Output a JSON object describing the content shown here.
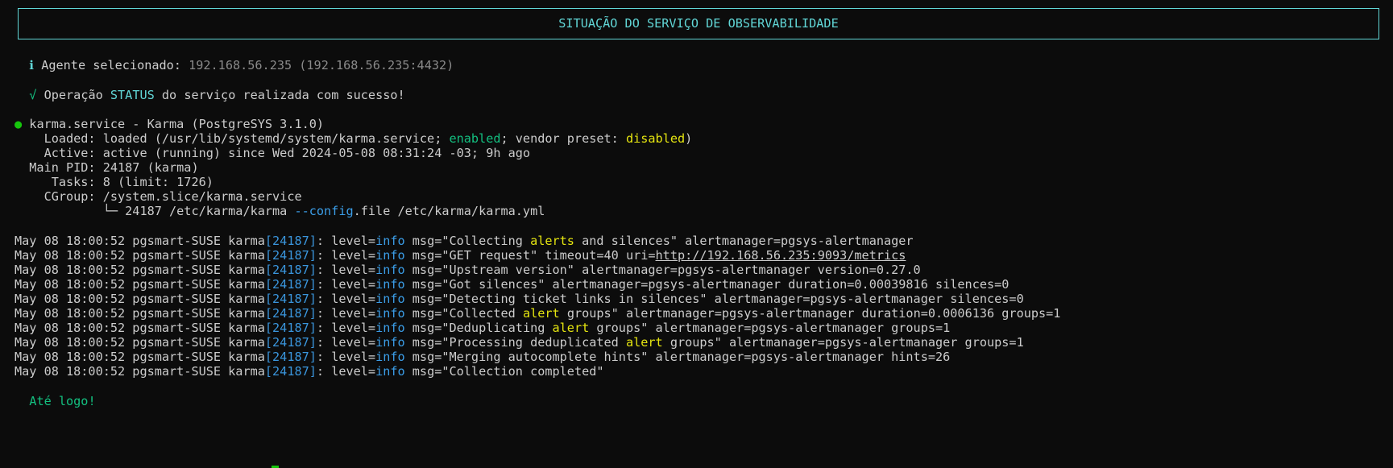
{
  "banner": {
    "title": "SITUAÇÃO DO SERVIÇO DE OBSERVABILIDADE"
  },
  "agent": {
    "icon": "ℹ",
    "label": " Agente selecionado: ",
    "value": "192.168.56.235 (192.168.56.235:4432)"
  },
  "operation": {
    "icon": "√",
    "prefix": " Operação ",
    "keyword": "STATUS",
    "suffix": " do serviço realizada com sucesso!"
  },
  "service": {
    "bullet": "●",
    "header": " karma.service - Karma (PostgreSYS 3.1.0)",
    "loaded_prefix": "    Loaded: loaded (/usr/lib/systemd/system/karma.service; ",
    "loaded_enabled": "enabled",
    "loaded_mid": "; vendor preset: ",
    "loaded_disabled": "disabled",
    "loaded_end": ")",
    "active": "    Active: active (running) since Wed 2024-05-08 08:31:24 -03; 9h ago",
    "main_pid": "  Main PID: 24187 (karma)",
    "tasks": "     Tasks: 8 (limit: 1726)",
    "cgroup": "    CGroup: /system.slice/karma.service",
    "cgroup_child_prefix": "            └─ 24187 /etc/karma/karma ",
    "cgroup_child_flag": "--config",
    "cgroup_child_suffix": ".file /etc/karma/karma.yml"
  },
  "log": {
    "prefix": "May 08 18:00:52 pgsmart-SUSE karma",
    "pid": "[24187]",
    "level_label": ": level=",
    "level_value": "info",
    "lines": [
      {
        "a": " msg=\"Collecting ",
        "hl": "alerts",
        "b": " and silences\" alertmanager=pgsys-alertmanager",
        "url": ""
      },
      {
        "a": " msg=\"GET request\" timeout=40 uri=",
        "hl": "",
        "b": "",
        "url": "http://192.168.56.235:9093/metrics"
      },
      {
        "a": " msg=\"Upstream version\" alertmanager=pgsys-alertmanager version=0.27.0",
        "hl": "",
        "b": "",
        "url": ""
      },
      {
        "a": " msg=\"Got silences\" alertmanager=pgsys-alertmanager duration=0.00039816 silences=0",
        "hl": "",
        "b": "",
        "url": ""
      },
      {
        "a": " msg=\"Detecting ticket links in silences\" alertmanager=pgsys-alertmanager silences=0",
        "hl": "",
        "b": "",
        "url": ""
      },
      {
        "a": " msg=\"Collected ",
        "hl": "alert",
        "b": " groups\" alertmanager=pgsys-alertmanager duration=0.0006136 groups=1",
        "url": ""
      },
      {
        "a": " msg=\"Deduplicating ",
        "hl": "alert",
        "b": " groups\" alertmanager=pgsys-alertmanager groups=1",
        "url": ""
      },
      {
        "a": " msg=\"Processing deduplicated ",
        "hl": "alert",
        "b": " groups\" alertmanager=pgsys-alertmanager groups=1",
        "url": ""
      },
      {
        "a": " msg=\"Merging autocomplete hints\" alertmanager=pgsys-alertmanager hints=26",
        "hl": "",
        "b": "",
        "url": ""
      },
      {
        "a": " msg=\"Collection completed\"",
        "hl": "",
        "b": "",
        "url": ""
      }
    ]
  },
  "goodbye": "Até logo!"
}
